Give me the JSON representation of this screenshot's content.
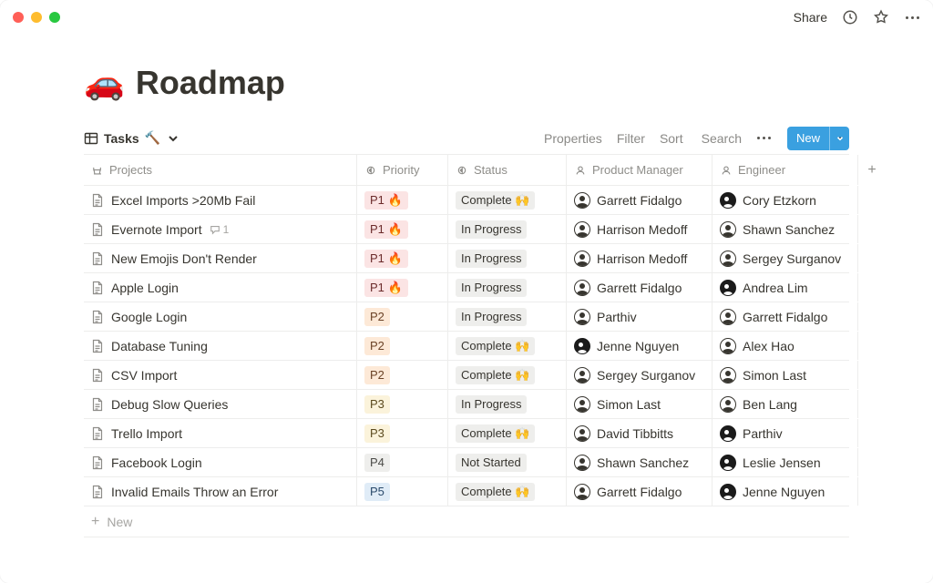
{
  "top": {
    "share": "Share"
  },
  "page": {
    "emoji": "🚗",
    "title": "Roadmap"
  },
  "view": {
    "name": "Tasks",
    "emoji": "🔨"
  },
  "toolbar": {
    "properties": "Properties",
    "filter": "Filter",
    "sort": "Sort",
    "search": "Search",
    "new": "New"
  },
  "columns": {
    "projects": "Projects",
    "priority": "Priority",
    "status": "Status",
    "pm": "Product Manager",
    "eng": "Engineer"
  },
  "rows": [
    {
      "name": "Excel Imports >20Mb Fail",
      "comments": 0,
      "priority": "P1 🔥",
      "pclass": "p1",
      "status": "Complete 🙌",
      "pm": "Garrett Fidalgo",
      "eng": "Cory Etzkorn",
      "pmDark": false,
      "engDark": true
    },
    {
      "name": "Evernote Import",
      "comments": 1,
      "priority": "P1 🔥",
      "pclass": "p1",
      "status": "In Progress",
      "pm": "Harrison Medoff",
      "eng": "Shawn Sanchez",
      "pmDark": false,
      "engDark": false
    },
    {
      "name": "New Emojis Don't Render",
      "comments": 0,
      "priority": "P1 🔥",
      "pclass": "p1",
      "status": "In Progress",
      "pm": "Harrison Medoff",
      "eng": "Sergey Surganov",
      "pmDark": false,
      "engDark": false
    },
    {
      "name": "Apple Login",
      "comments": 0,
      "priority": "P1 🔥",
      "pclass": "p1",
      "status": "In Progress",
      "pm": "Garrett Fidalgo",
      "eng": "Andrea Lim",
      "pmDark": false,
      "engDark": true
    },
    {
      "name": "Google Login",
      "comments": 0,
      "priority": "P2",
      "pclass": "p2",
      "status": "In Progress",
      "pm": "Parthiv",
      "eng": "Garrett Fidalgo",
      "pmDark": false,
      "engDark": false
    },
    {
      "name": "Database Tuning",
      "comments": 0,
      "priority": "P2",
      "pclass": "p2",
      "status": "Complete 🙌",
      "pm": "Jenne Nguyen",
      "eng": "Alex Hao",
      "pmDark": true,
      "engDark": false
    },
    {
      "name": "CSV Import",
      "comments": 0,
      "priority": "P2",
      "pclass": "p2",
      "status": "Complete 🙌",
      "pm": "Sergey Surganov",
      "eng": "Simon Last",
      "pmDark": false,
      "engDark": false
    },
    {
      "name": "Debug Slow Queries",
      "comments": 0,
      "priority": "P3",
      "pclass": "p3",
      "status": "In Progress",
      "pm": "Simon Last",
      "eng": "Ben Lang",
      "pmDark": false,
      "engDark": false
    },
    {
      "name": "Trello Import",
      "comments": 0,
      "priority": "P3",
      "pclass": "p3",
      "status": "Complete 🙌",
      "pm": "David Tibbitts",
      "eng": "Parthiv",
      "pmDark": false,
      "engDark": true
    },
    {
      "name": "Facebook Login",
      "comments": 0,
      "priority": "P4",
      "pclass": "p4",
      "status": "Not Started",
      "pm": "Shawn Sanchez",
      "eng": "Leslie Jensen",
      "pmDark": false,
      "engDark": true
    },
    {
      "name": "Invalid Emails Throw an Error",
      "comments": 0,
      "priority": "P5",
      "pclass": "p5",
      "status": "Complete 🙌",
      "pm": "Garrett Fidalgo",
      "eng": "Jenne Nguyen",
      "pmDark": false,
      "engDark": true
    }
  ],
  "newrow": "New"
}
